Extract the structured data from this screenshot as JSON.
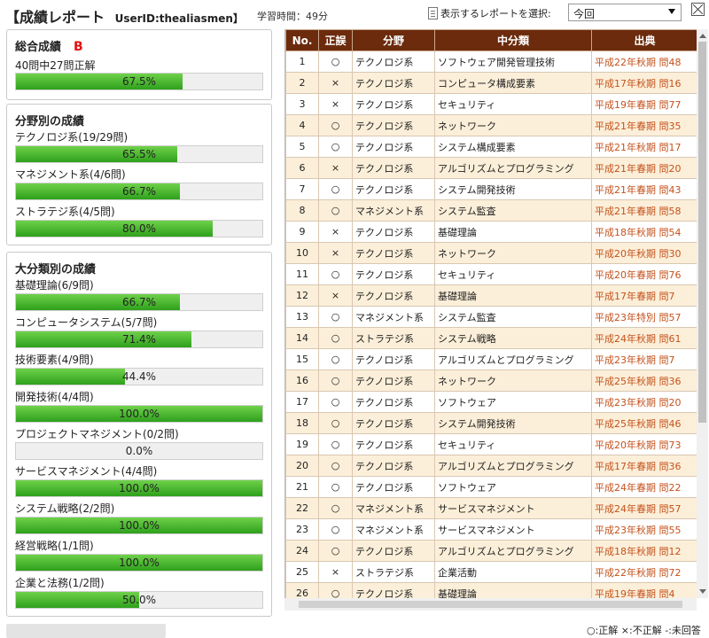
{
  "header": {
    "title": "【成績レポート",
    "user_id": "UserID:thealiasmen】",
    "study_time": "学習時間：49分",
    "select_label": "表示するレポートを選択:",
    "select_value": "今回"
  },
  "overall": {
    "title": "総合成績",
    "grade": "B",
    "summary": "40問中27問正解",
    "percent_text": "67.5%",
    "percent": 67.5
  },
  "field": {
    "title": "分野別の成績",
    "items": [
      {
        "label": "テクノロジ系(19/29問)",
        "percent_text": "65.5%",
        "percent": 65.5
      },
      {
        "label": "マネジメント系(4/6問)",
        "percent_text": "66.7%",
        "percent": 66.7
      },
      {
        "label": "ストラテジ系(4/5問)",
        "percent_text": "80.0%",
        "percent": 80.0
      }
    ]
  },
  "category": {
    "title": "大分類別の成績",
    "items": [
      {
        "label": "基礎理論(6/9問)",
        "percent_text": "66.7%",
        "percent": 66.7
      },
      {
        "label": "コンピュータシステム(5/7問)",
        "percent_text": "71.4%",
        "percent": 71.4
      },
      {
        "label": "技術要素(4/9問)",
        "percent_text": "44.4%",
        "percent": 44.4
      },
      {
        "label": "開発技術(4/4問)",
        "percent_text": "100.0%",
        "percent": 100.0
      },
      {
        "label": "プロジェクトマネジメント(0/2問)",
        "percent_text": "0.0%",
        "percent": 0.0
      },
      {
        "label": "サービスマネジメント(4/4問)",
        "percent_text": "100.0%",
        "percent": 100.0
      },
      {
        "label": "システム戦略(2/2問)",
        "percent_text": "100.0%",
        "percent": 100.0
      },
      {
        "label": "経営戦略(1/1問)",
        "percent_text": "100.0%",
        "percent": 100.0
      },
      {
        "label": "企業と法務(1/2問)",
        "percent_text": "50.0%",
        "percent": 50.0
      }
    ]
  },
  "table": {
    "headers": [
      "No.",
      "正誤",
      "分野",
      "中分類",
      "出典"
    ],
    "rows": [
      [
        "1",
        "○",
        "テクノロジ系",
        "ソフトウェア開発管理技術",
        "平成22年秋期 問48"
      ],
      [
        "2",
        "×",
        "テクノロジ系",
        "コンピュータ構成要素",
        "平成17年秋期 問16"
      ],
      [
        "3",
        "×",
        "テクノロジ系",
        "セキュリティ",
        "平成19年春期 問77"
      ],
      [
        "4",
        "○",
        "テクノロジ系",
        "ネットワーク",
        "平成21年春期 問35"
      ],
      [
        "5",
        "○",
        "テクノロジ系",
        "システム構成要素",
        "平成21年秋期 問17"
      ],
      [
        "6",
        "×",
        "テクノロジ系",
        "アルゴリズムとプログラミング",
        "平成21年春期 問20"
      ],
      [
        "7",
        "○",
        "テクノロジ系",
        "システム開発技術",
        "平成21年春期 問43"
      ],
      [
        "8",
        "○",
        "マネジメント系",
        "システム監査",
        "平成21年春期 問58"
      ],
      [
        "9",
        "×",
        "テクノロジ系",
        "基礎理論",
        "平成18年秋期 問54"
      ],
      [
        "10",
        "×",
        "テクノロジ系",
        "ネットワーク",
        "平成20年秋期 問30"
      ],
      [
        "11",
        "○",
        "テクノロジ系",
        "セキュリティ",
        "平成20年春期 問76"
      ],
      [
        "12",
        "×",
        "テクノロジ系",
        "基礎理論",
        "平成17年春期 問7"
      ],
      [
        "13",
        "○",
        "マネジメント系",
        "システム監査",
        "平成23年特別 問57"
      ],
      [
        "14",
        "○",
        "ストラテジ系",
        "システム戦略",
        "平成24年秋期 問61"
      ],
      [
        "15",
        "○",
        "テクノロジ系",
        "アルゴリズムとプログラミング",
        "平成23年秋期 問7"
      ],
      [
        "16",
        "○",
        "テクノロジ系",
        "ネットワーク",
        "平成25年秋期 問36"
      ],
      [
        "17",
        "○",
        "テクノロジ系",
        "ソフトウェア",
        "平成23年秋期 問20"
      ],
      [
        "18",
        "○",
        "テクノロジ系",
        "システム開発技術",
        "平成25年秋期 問46"
      ],
      [
        "19",
        "○",
        "テクノロジ系",
        "セキュリティ",
        "平成20年秋期 問73"
      ],
      [
        "20",
        "○",
        "テクノロジ系",
        "アルゴリズムとプログラミング",
        "平成17年春期 問36"
      ],
      [
        "21",
        "○",
        "テクノロジ系",
        "ソフトウェア",
        "平成24年春期 問22"
      ],
      [
        "22",
        "○",
        "マネジメント系",
        "サービスマネジメント",
        "平成24年春期 問57"
      ],
      [
        "23",
        "○",
        "マネジメント系",
        "サービスマネジメント",
        "平成23年秋期 問55"
      ],
      [
        "24",
        "○",
        "テクノロジ系",
        "アルゴリズムとプログラミング",
        "平成18年秋期 問12"
      ],
      [
        "25",
        "×",
        "ストラテジ系",
        "企業活動",
        "平成22年秋期 問72"
      ],
      [
        "26",
        "○",
        "テクノロジ系",
        "基礎理論",
        "平成19年春期 問4"
      ]
    ]
  },
  "legend": "○:正解 ×:不正解 -:未回答"
}
